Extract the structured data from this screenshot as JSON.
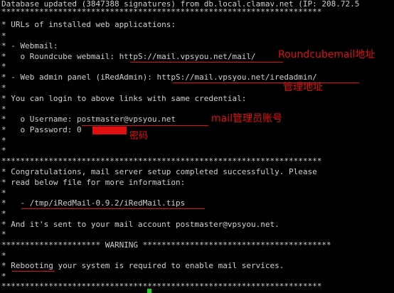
{
  "terminal": {
    "lines": [
      "Database updated (3847388 signatures) from db.local.clamav.net (IP: 208.72.5",
      "********************************************************************",
      "* URLs of installed web applications:",
      "*",
      "* - Webmail:",
      "*   o Roundcube webmail: httpS://mail.vpsyou.net/mail/",
      "*",
      "* - Web admin panel (iRedAdmin): httpS://mail.vpsyou.net/iredadmin/",
      "*",
      "* You can login to above links with same credential:",
      "*",
      "*   o Username: postmaster@vpsyou.net",
      "*   o Password: 0",
      "*",
      "*",
      "********************************************************************",
      "* Congratulations, mail server setup completed successfully. Please",
      "* read below file for more information:",
      "*",
      "*   - /tmp/iRedMail-0.9.2/iRedMail.tips",
      "*",
      "* And it's sent to your mail account postmaster@vpsyou.net.",
      "*",
      "********************* WARNING ****************************************",
      "*",
      "* Rebooting your system is required to enable mail services.",
      "*",
      "********************************************************************"
    ]
  },
  "annotations": {
    "roundcube": "Roundcubemail地址",
    "admin": "管理地址",
    "account": "mail管理员账号",
    "password": "密码"
  },
  "colors": {
    "background": "#000000",
    "text": "#d0d0d0",
    "annotation": "#e01010",
    "cursor": "#1fd01f"
  }
}
